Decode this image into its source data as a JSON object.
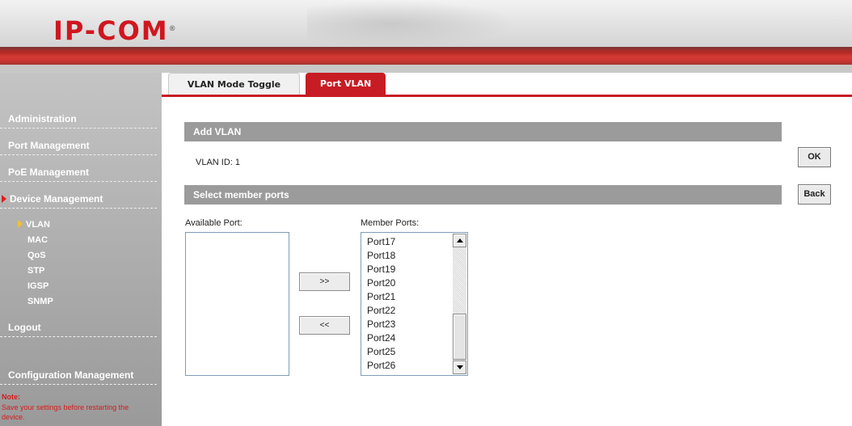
{
  "header": {
    "logo": "IP-COM",
    "logo_mark": "®"
  },
  "colors": {
    "accent": "#c81c24",
    "sidebar": "#aaaaaa",
    "section_bar": "#9b9b9b"
  },
  "sidebar": {
    "items": [
      {
        "label": "Administration"
      },
      {
        "label": "Port Management"
      },
      {
        "label": "PoE Management"
      },
      {
        "label": "Device Management"
      }
    ],
    "subitems": [
      {
        "label": "VLAN"
      },
      {
        "label": "MAC"
      },
      {
        "label": "QoS"
      },
      {
        "label": "STP"
      },
      {
        "label": "IGSP"
      },
      {
        "label": "SNMP"
      }
    ],
    "logout": "Logout",
    "config": "Configuration Management",
    "note_title": "Note:",
    "note_text": "Save your settings before restarting the device."
  },
  "tabs": [
    {
      "label": "VLAN Mode Toggle"
    },
    {
      "label": "Port VLAN"
    }
  ],
  "main": {
    "add_title": "Add VLAN",
    "vlan_id": "VLAN ID: 1",
    "select_title": "Select member ports",
    "available_label": "Available Port:",
    "member_label": "Member Ports:",
    "add_btn": ">>",
    "remove_btn": "<<",
    "member_ports": [
      "Port17",
      "Port18",
      "Port19",
      "Port20",
      "Port21",
      "Port22",
      "Port23",
      "Port24",
      "Port25",
      "Port26"
    ]
  },
  "actions": {
    "ok": "OK",
    "back": "Back"
  }
}
